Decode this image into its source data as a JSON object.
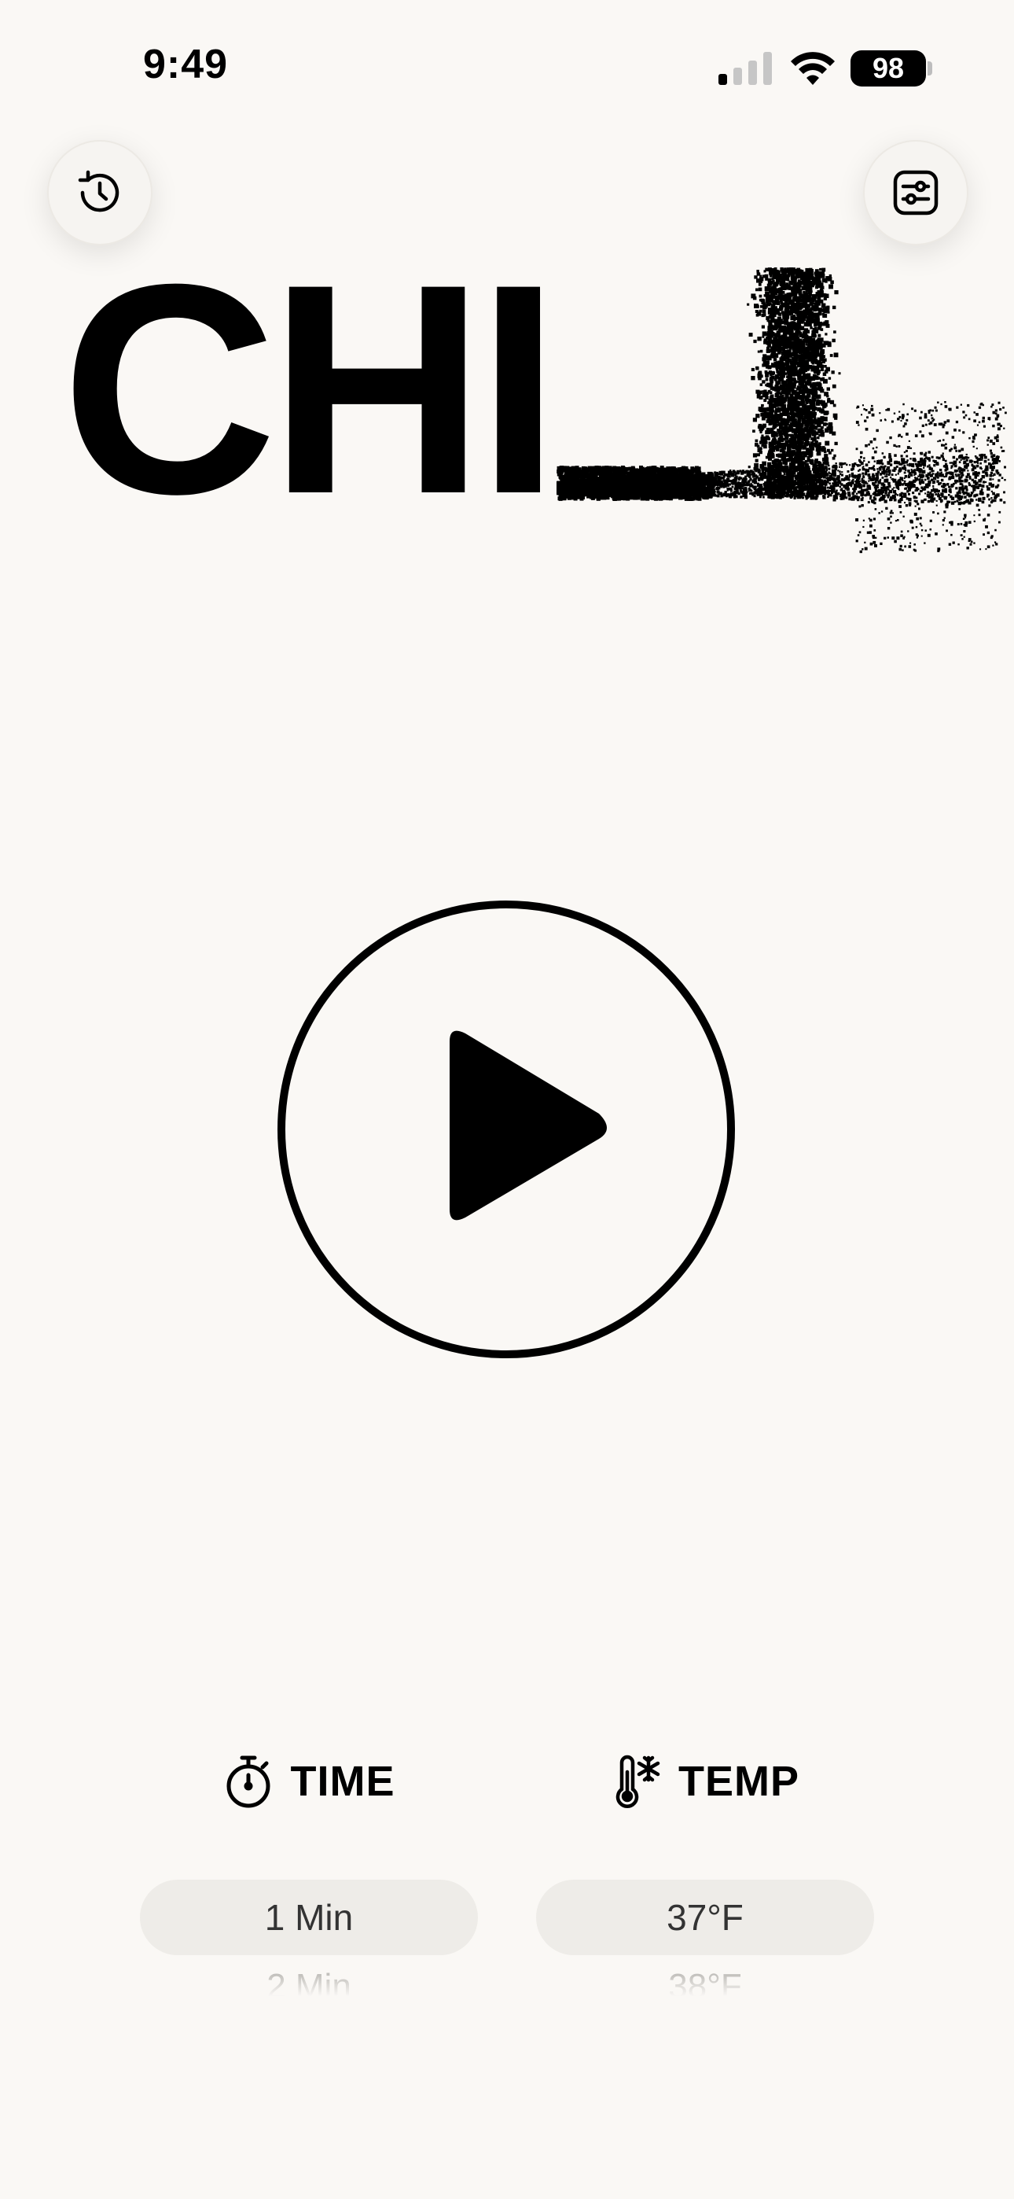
{
  "status_bar": {
    "time": "9:49",
    "battery": "98"
  },
  "header": {
    "history_icon": "history-icon",
    "settings_icon": "sliders-icon"
  },
  "title": {
    "text": "CHILL"
  },
  "play": {
    "icon": "play-icon"
  },
  "time_picker": {
    "label": "TIME",
    "icon": "stopwatch-icon",
    "selected": "1 Min",
    "next": "2 Min"
  },
  "temp_picker": {
    "label": "TEMP",
    "icon": "thermometer-snowflake-icon",
    "selected": "37°F",
    "next": "38°F"
  },
  "colors": {
    "background": "#FAF8F5",
    "foreground": "#000000",
    "pill": "#EEECE8"
  }
}
